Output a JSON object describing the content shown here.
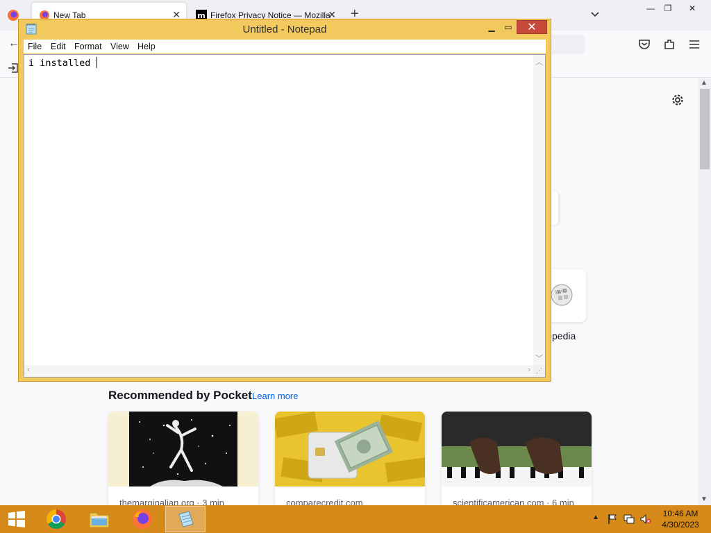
{
  "browser": {
    "tabs": [
      {
        "label": "New Tab",
        "active": true
      },
      {
        "label": "Firefox Privacy Notice — Mozilla",
        "active": false
      }
    ],
    "toolbar_icons": [
      "back-arrow-icon",
      "pocket-icon",
      "extensions-icon",
      "menu-icon",
      "import-icon"
    ]
  },
  "newtab": {
    "shortcut_label": "tipedia",
    "pocket": {
      "heading": "Recommended by Pocket",
      "learn_more": "Learn more",
      "cards": [
        {
          "source": "themarginalian.org · 3 min"
        },
        {
          "source": "comparecredit.com"
        },
        {
          "source": "scientificamerican.com · 6 min"
        }
      ]
    }
  },
  "notepad": {
    "title": "Untitled - Notepad",
    "menu": [
      "File",
      "Edit",
      "Format",
      "View",
      "Help"
    ],
    "content": "i installed "
  },
  "taskbar": {
    "apps": [
      "chrome",
      "file-explorer",
      "firefox",
      "notepad"
    ],
    "active_app": "notepad",
    "time": "10:46 AM",
    "date": "4/30/2023"
  },
  "colors": {
    "notepad_frame": "#f2c95c",
    "taskbar": "#d68a1a",
    "close_button": "#c7493a",
    "link": "#0061e0"
  }
}
